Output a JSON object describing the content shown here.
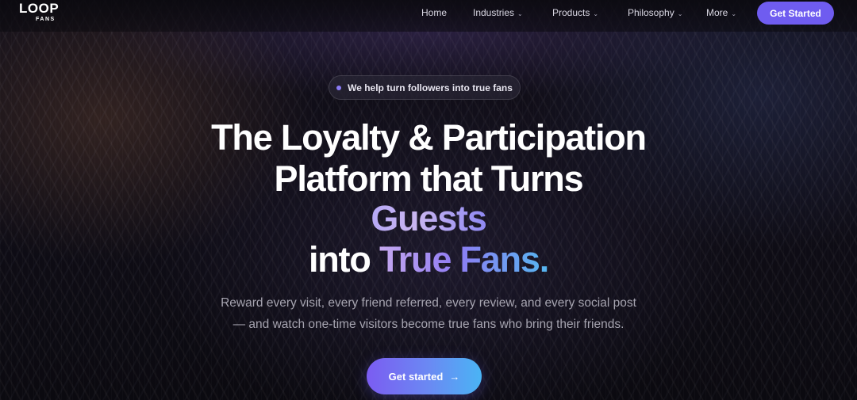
{
  "brand": {
    "logo_word": "LOOP",
    "logo_sub": "FANS"
  },
  "nav": {
    "home": "Home",
    "industries": "Industries",
    "products": "Products",
    "philosophy": "Philosophy",
    "more": "More",
    "chevron": "⌄",
    "cta": "Get Started"
  },
  "hero": {
    "badge": "We help turn followers into true fans",
    "line1": "The Loyalty & Participation",
    "line2": "Platform that Turns",
    "line3": "Guests",
    "line4_prefix": "into ",
    "line4_highlight": "True Fans.",
    "sub_line1": "Reward every visit, every friend referred, every review, and every social post",
    "sub_line2": "— and watch one-time visitors become true fans who bring their friends.",
    "cta": "Get started",
    "cta_arrow": "→"
  },
  "colors": {
    "accent": "#6f5cf0",
    "gradient_start": "#7b5cf2",
    "gradient_end": "#4ab4f4",
    "text": "#ffffff",
    "muted": "#a6a4b0"
  },
  "icons": {
    "badge": "dot-icon",
    "cta": "arrow-right-icon",
    "dropdown": "chevron-down-icon"
  }
}
